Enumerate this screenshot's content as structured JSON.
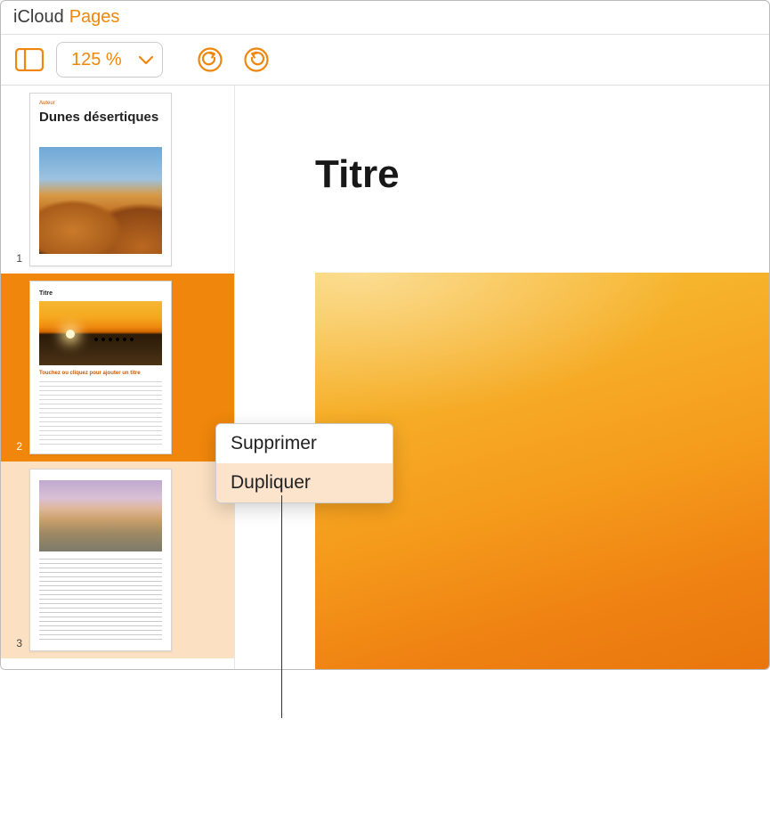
{
  "titlebar": {
    "brand_icloud": "iCloud",
    "brand_pages": "Pages"
  },
  "toolbar": {
    "zoom_value": "125 %"
  },
  "sidebar": {
    "thumbnails": [
      {
        "num": "1",
        "author_label": "Auteur",
        "title": "Dunes désertiques"
      },
      {
        "num": "2",
        "mini_title": "Titre",
        "subheading": "Touchez ou cliquez pour ajouter un titre"
      },
      {
        "num": "3"
      }
    ]
  },
  "canvas": {
    "page_title": "Titre"
  },
  "context_menu": {
    "items": [
      {
        "label": "Supprimer"
      },
      {
        "label": "Dupliquer"
      }
    ]
  }
}
